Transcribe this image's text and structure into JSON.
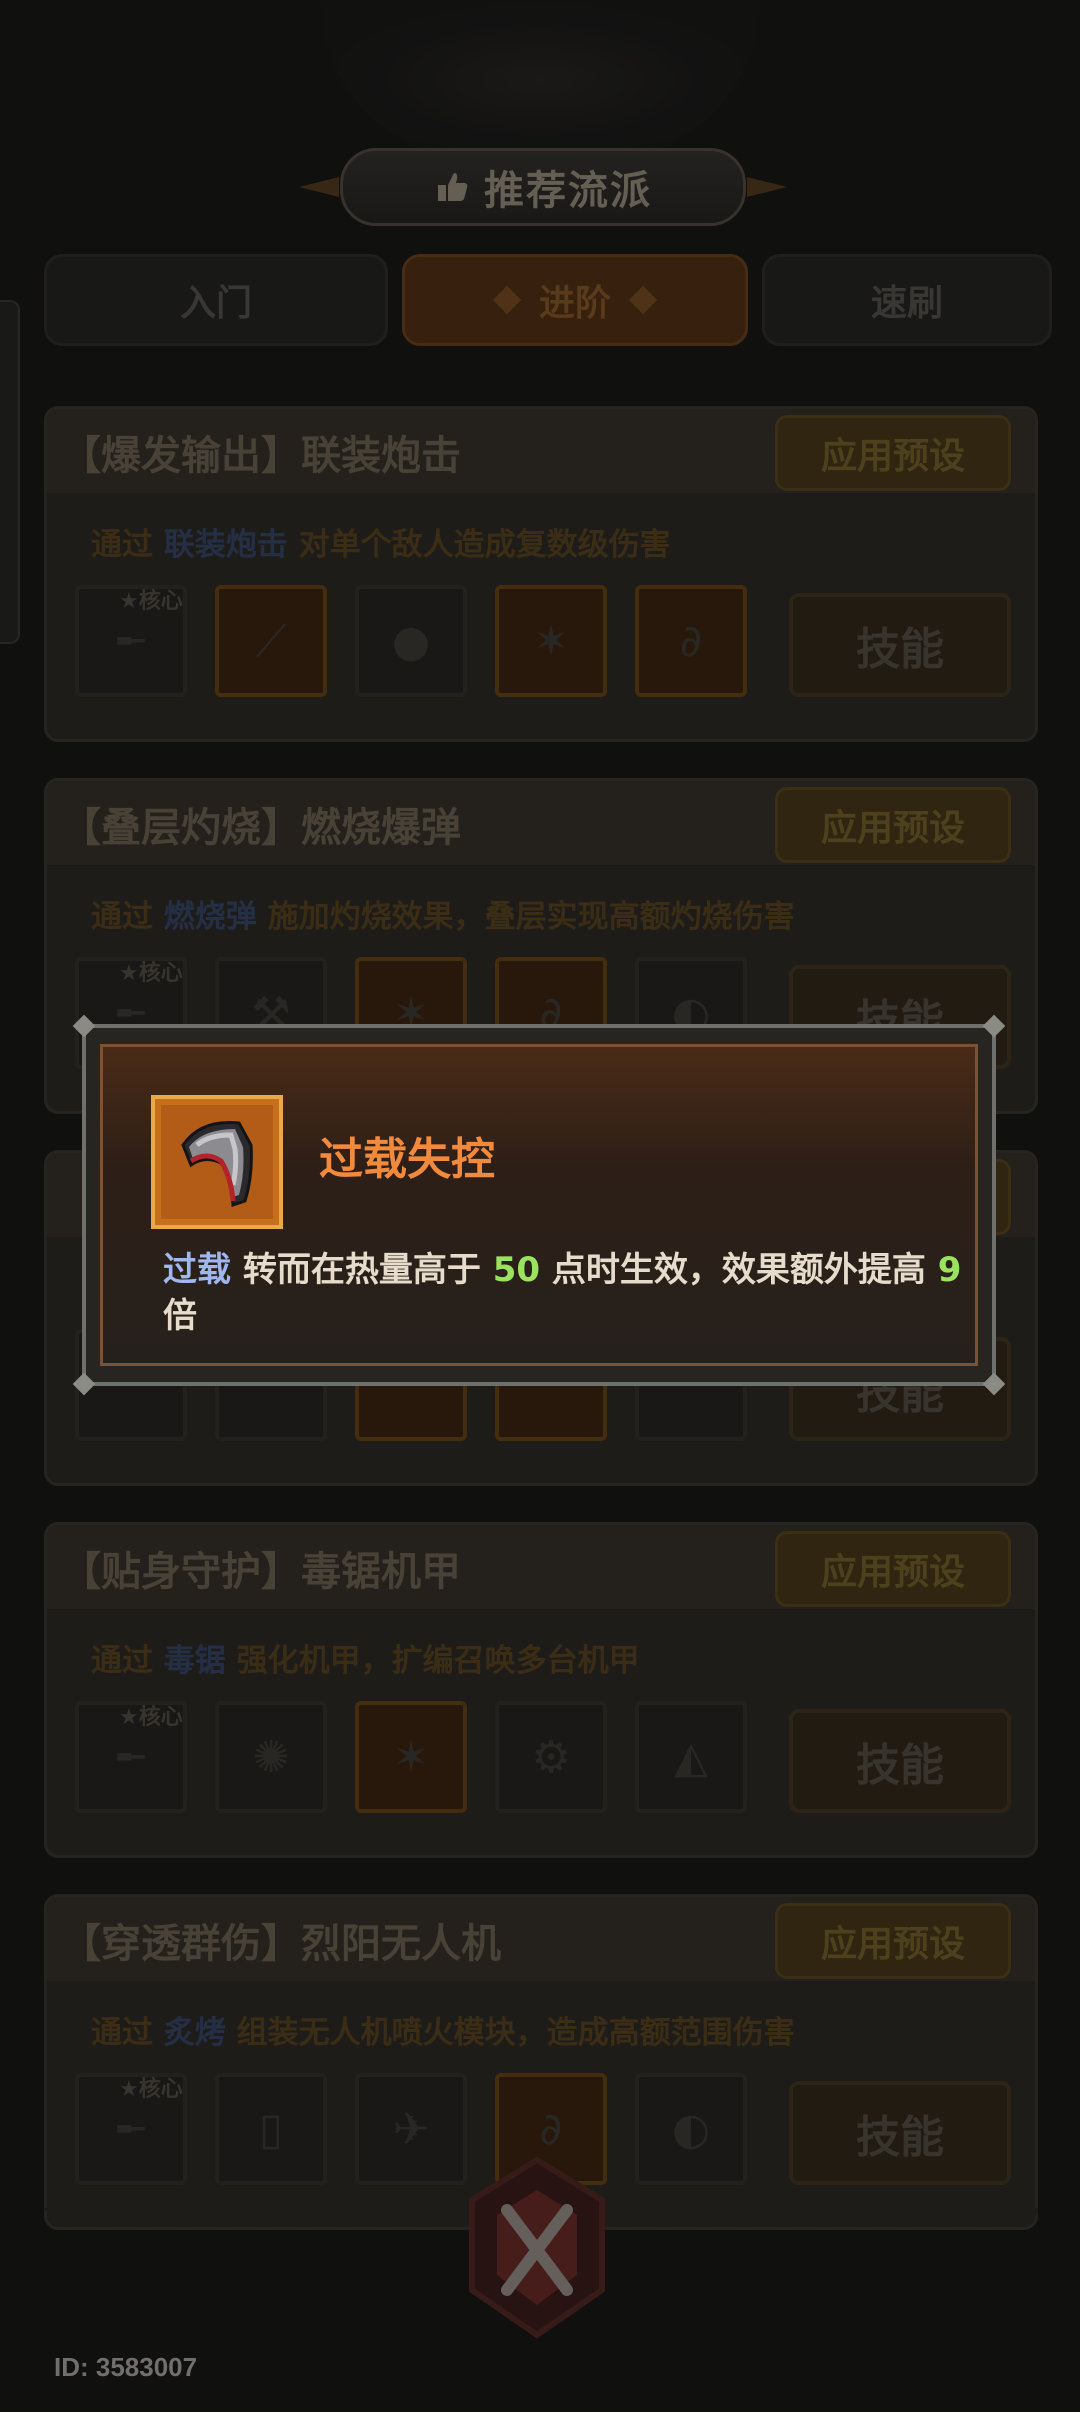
{
  "header": {
    "title": "推荐流派"
  },
  "tabs": [
    {
      "label": "入门"
    },
    {
      "label": "进阶"
    },
    {
      "label": "速刷"
    }
  ],
  "cards": [
    {
      "title": "【爆发输出】联装炮击",
      "apply_label": "应用预设",
      "desc_pre": "通过 ",
      "desc_kw": "联装炮击",
      "desc_post": " 对单个敌人造成复数级伤害",
      "core_label": "★核心",
      "skill_label": "技能"
    },
    {
      "title": "【叠层灼烧】燃烧爆弹",
      "apply_label": "应用预设",
      "desc_pre": "通过 ",
      "desc_kw": "燃烧弹",
      "desc_post": " 施加灼烧效果，叠层实现高额灼烧伤害",
      "core_label": "★核心",
      "skill_label": "技能"
    },
    {
      "title": "",
      "apply_label": "",
      "desc_pre": "",
      "desc_kw": "",
      "desc_post": "",
      "core_label": "",
      "skill_label": "技能"
    },
    {
      "title": "【贴身守护】毒锯机甲",
      "apply_label": "应用预设",
      "desc_pre": "通过 ",
      "desc_kw": "毒锯",
      "desc_post": " 强化机甲，扩编召唤多台机甲",
      "core_label": "★核心",
      "skill_label": "技能"
    },
    {
      "title": "【穿透群伤】烈阳无人机",
      "apply_label": "应用预设",
      "desc_pre": "通过 ",
      "desc_kw": "炙烤",
      "desc_post": " 组装无人机喷火模块，造成高额范围伤害",
      "core_label": "★核心",
      "skill_label": "技能"
    }
  ],
  "popup": {
    "title": "过载失控",
    "icon": "armor-plate-icon",
    "desc_kw": "过载",
    "desc_a": " 转而在热量高于 ",
    "desc_num1": "50",
    "desc_b": " 点时生效，效果额外提高 ",
    "desc_num2": "9",
    "desc_c": " 倍"
  },
  "footer": {
    "id_text": "ID: 3583007"
  },
  "colors": {
    "accent_orange": "#f28a3c",
    "keyword_blue": "#9fb6ee",
    "number_green": "#9be25e"
  }
}
